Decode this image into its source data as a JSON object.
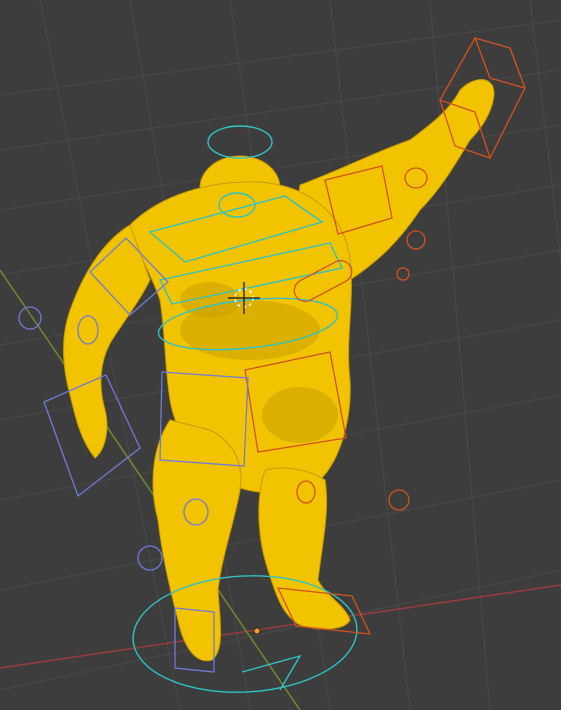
{
  "viewport": {
    "name": "3d-viewport",
    "colors": {
      "background": "#3d3d3d",
      "grid": "#4a4a4a",
      "x_axis": "#9a3b3b",
      "y_axis": "#6f8a32",
      "mesh": "#f2c300",
      "control_cyan": "#2fc3c3",
      "control_orange": "#d2521f",
      "control_blue": "#6f7bd8"
    }
  },
  "scene": {
    "object": "rigged-muscular-character-mesh",
    "icons": [
      "3d-cursor-icon",
      "origin-point-icon"
    ]
  }
}
